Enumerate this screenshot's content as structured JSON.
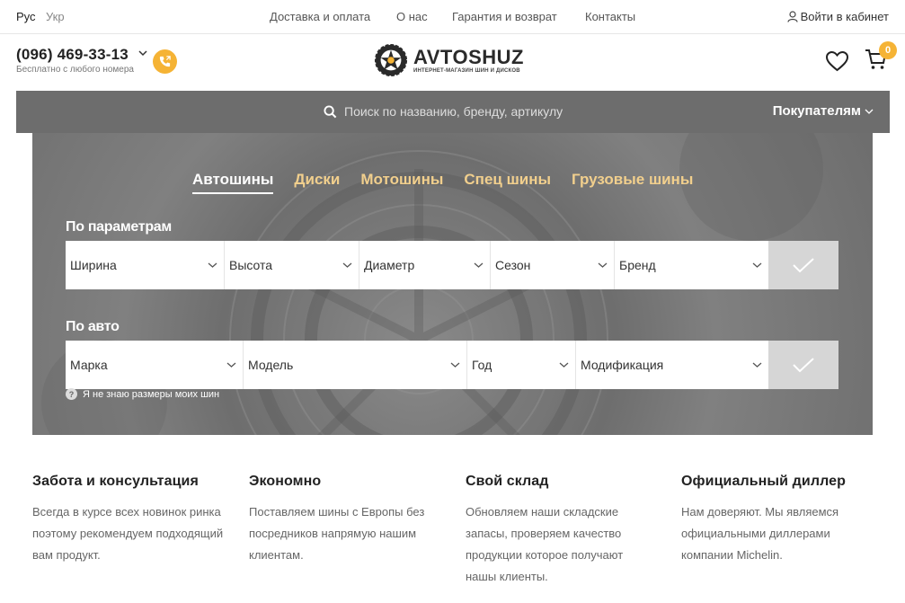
{
  "topbar": {
    "lang_ru": "Рус",
    "lang_uk": "Укр",
    "nav": [
      "Доставка и оплата",
      "О нас",
      "Гарантия и возврат",
      "Контакты"
    ],
    "login": "Войти в кабинет"
  },
  "header": {
    "phone": "(096) 469-33-13",
    "phone_sub": "Бесплатно с любого номера",
    "logo_name": "AVTOSHUZ",
    "logo_tagline": "ИНТЕРНЕТ-МАГАЗИН ШИН И ДИСКОВ",
    "cart_count": "0"
  },
  "search": {
    "placeholder": "Поиск по названию, бренду, артикулу",
    "buyers_label": "Покупателям"
  },
  "hero": {
    "tabs": [
      "Автошины",
      "Диски",
      "Мотошины",
      "Спец шины",
      "Грузовые шины"
    ],
    "params_label": "По параметрам",
    "params_fields": [
      "Ширина",
      "Высота",
      "Диаметр",
      "Сезон",
      "Бренд"
    ],
    "auto_label": "По авто",
    "auto_fields": [
      "Марка",
      "Модель",
      "Год",
      "Модификация"
    ],
    "hint": "Я не знаю размеры моих шин"
  },
  "features": [
    {
      "title": "Забота и консультация",
      "text": "Всегда в курсе всех новинок ринка поэтому рекомендуем подходящий вам продукт."
    },
    {
      "title": "Экономно",
      "text": "Поставляем шины с Европы без посредников напрямую нашим клиентам."
    },
    {
      "title": "Свой склад",
      "text": "Обновляем наши складские запасы, проверяем качество продукции которое получают нашы клиенты."
    },
    {
      "title": "Официальный диллер",
      "text": "Нам доверяют. Мы являемся официальными диллерами компании Michelin."
    }
  ],
  "colors": {
    "accent": "#f5b335",
    "tab_inactive": "#f1cf8d",
    "bar": "#6d6d6d"
  }
}
